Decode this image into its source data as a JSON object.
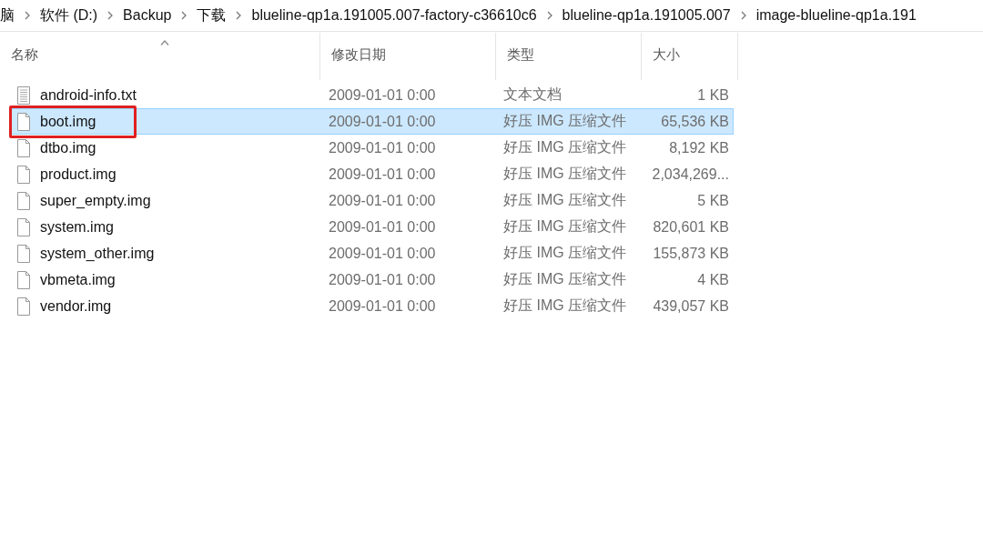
{
  "breadcrumb": [
    "脑",
    "软件 (D:)",
    "Backup",
    "下载",
    "blueline-qp1a.191005.007-factory-c36610c6",
    "blueline-qp1a.191005.007",
    "image-blueline-qp1a.191"
  ],
  "columns": [
    {
      "label": "名称",
      "sorted": true
    },
    {
      "label": "修改日期",
      "sorted": false
    },
    {
      "label": "类型",
      "sorted": false
    },
    {
      "label": "大小",
      "sorted": false
    }
  ],
  "rows": [
    {
      "kind": "text",
      "name": "android-info.txt",
      "date": "2009-01-01 0:00",
      "type": "文本文档",
      "size": "1 KB",
      "selected": false,
      "annotated": false
    },
    {
      "kind": "file",
      "name": "boot.img",
      "date": "2009-01-01 0:00",
      "type": "好压 IMG 压缩文件",
      "size": "65,536 KB",
      "selected": true,
      "annotated": true
    },
    {
      "kind": "file",
      "name": "dtbo.img",
      "date": "2009-01-01 0:00",
      "type": "好压 IMG 压缩文件",
      "size": "8,192 KB",
      "selected": false,
      "annotated": false
    },
    {
      "kind": "file",
      "name": "product.img",
      "date": "2009-01-01 0:00",
      "type": "好压 IMG 压缩文件",
      "size": "2,034,269...",
      "selected": false,
      "annotated": false
    },
    {
      "kind": "file",
      "name": "super_empty.img",
      "date": "2009-01-01 0:00",
      "type": "好压 IMG 压缩文件",
      "size": "5 KB",
      "selected": false,
      "annotated": false
    },
    {
      "kind": "file",
      "name": "system.img",
      "date": "2009-01-01 0:00",
      "type": "好压 IMG 压缩文件",
      "size": "820,601 KB",
      "selected": false,
      "annotated": false
    },
    {
      "kind": "file",
      "name": "system_other.img",
      "date": "2009-01-01 0:00",
      "type": "好压 IMG 压缩文件",
      "size": "155,873 KB",
      "selected": false,
      "annotated": false
    },
    {
      "kind": "file",
      "name": "vbmeta.img",
      "date": "2009-01-01 0:00",
      "type": "好压 IMG 压缩文件",
      "size": "4 KB",
      "selected": false,
      "annotated": false
    },
    {
      "kind": "file",
      "name": "vendor.img",
      "date": "2009-01-01 0:00",
      "type": "好压 IMG 压缩文件",
      "size": "439,057 KB",
      "selected": false,
      "annotated": false
    }
  ]
}
